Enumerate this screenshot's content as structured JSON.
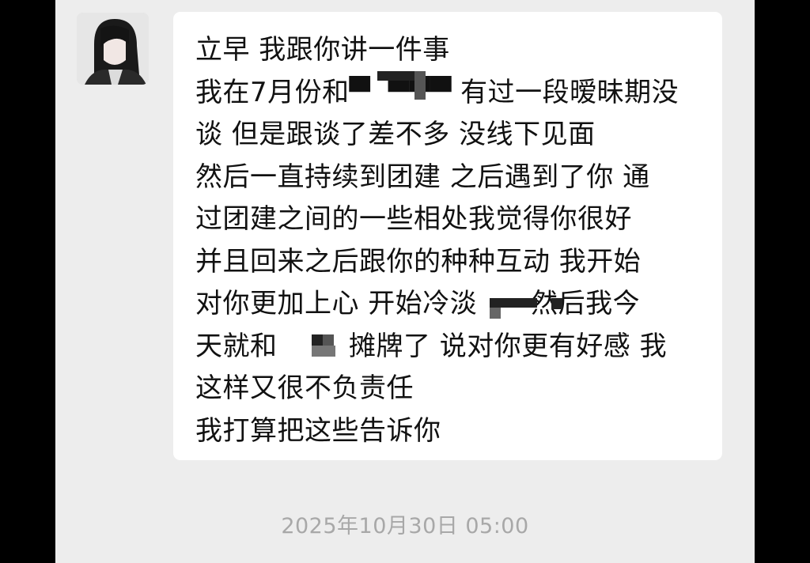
{
  "message": {
    "lines": [
      "立早 我跟你讲一件事",
      "我在7月份和▀  ▀▀▀ 有过一段暧昧期没",
      "谈 但是跟谈了差不多 没线下见面",
      "然后一直持续到团建 之后遇到了你 通",
      "过团建之间的一些相处我觉得你很好",
      "并且回来之后跟你的种种互动 我开始",
      "对你更加上心 开始冷淡      然后我今",
      "天就和        摊牌了 说对你更有好感 我",
      "这样又很不负责任",
      "我打算把这些告诉你"
    ]
  },
  "timestamp": "2025年10月30日 05:00",
  "avatar": {
    "icon": "profile-avatar-dark-hair"
  },
  "colors": {
    "background": "#ededed",
    "bubble": "#ffffff",
    "text": "#111111",
    "timestamp": "#a8a8a8"
  }
}
